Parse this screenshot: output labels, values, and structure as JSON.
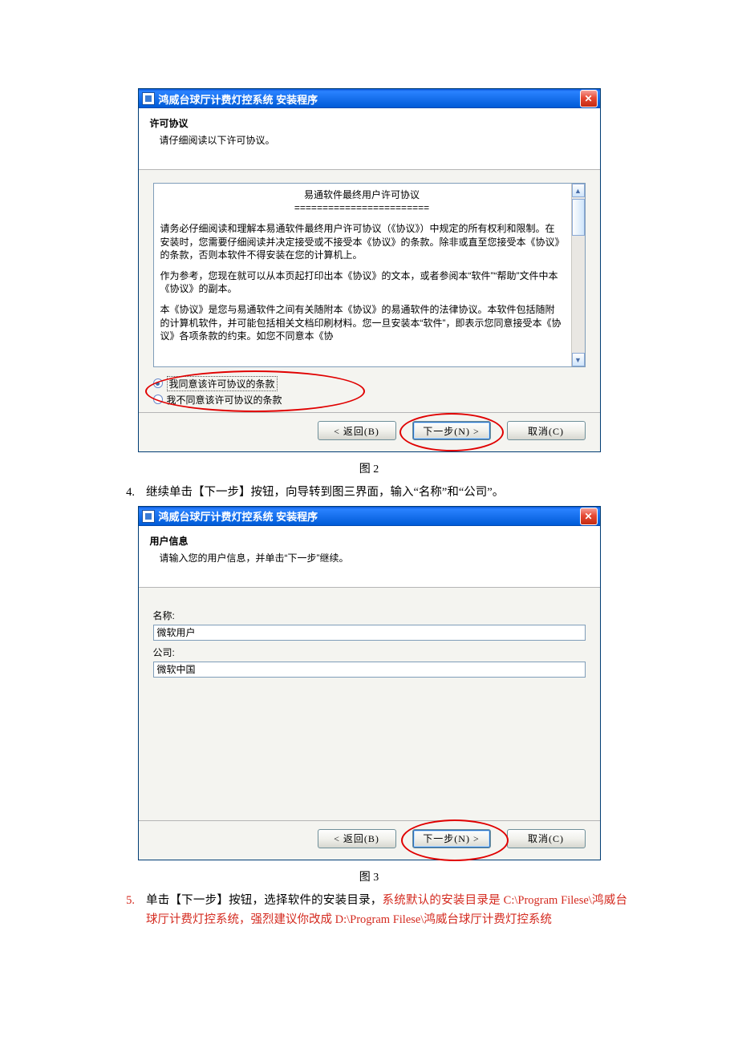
{
  "window": {
    "title": "鸿威台球厅计费灯控系统 安装程序",
    "close": "✕"
  },
  "license_page": {
    "header_title": "许可协议",
    "header_sub": "请仔细阅读以下许可协议。",
    "eula_title": "易通软件最终用户许可协议",
    "eula_sep": "========================",
    "p1": "请务必仔细阅读和理解本易通软件最终用户许可协议（《协议》）中规定的所有权利和限制。在安装时，您需要仔细阅读并决定接受或不接受本《协议》的条款。除非或直至您接受本《协议》的条款，否则本软件不得安装在您的计算机上。",
    "p2": "作为参考，您现在就可以从本页起打印出本《协议》的文本，或者参阅本“软件”“帮助”文件中本《协议》的副本。",
    "p3": "本《协议》是您与易通软件之间有关随附本《协议》的易通软件的法律协议。本软件包括随附的计算机软件，并可能包括相关文档印刷材料。您一旦安装本“软件”，即表示您同意接受本《协议》各项条款的约束。如您不同意本《协",
    "radio_agree": "我同意该许可协议的条款",
    "radio_disagree": "我不同意该许可协议的条款"
  },
  "user_page": {
    "header_title": "用户信息",
    "header_sub": "请输入您的用户信息，并单击“下一步”继续。",
    "name_label": "名称:",
    "name_value": "微软用户",
    "company_label": "公司:",
    "company_value": "微软中国"
  },
  "buttons": {
    "back": "< 返回(B)",
    "next": "下一步(N) >",
    "cancel": "取消(C)"
  },
  "captions": {
    "fig2": "图 2",
    "fig3": "图 3"
  },
  "steps": {
    "s4_num": "4.",
    "s4_text": "继续单击【下一步】按钮，向导转到图三界面，输入“名称”和“公司”。",
    "s5_num": "5.",
    "s5_pre": "单击【下一步】按钮，选择软件的安装目录，",
    "s5_red": "系统默认的安装目录是 C:\\Program Filese\\鸿威台球厅计费灯控系统，强烈建议你改成 D:\\Program Filese\\鸿威台球厅计费灯控系统"
  }
}
